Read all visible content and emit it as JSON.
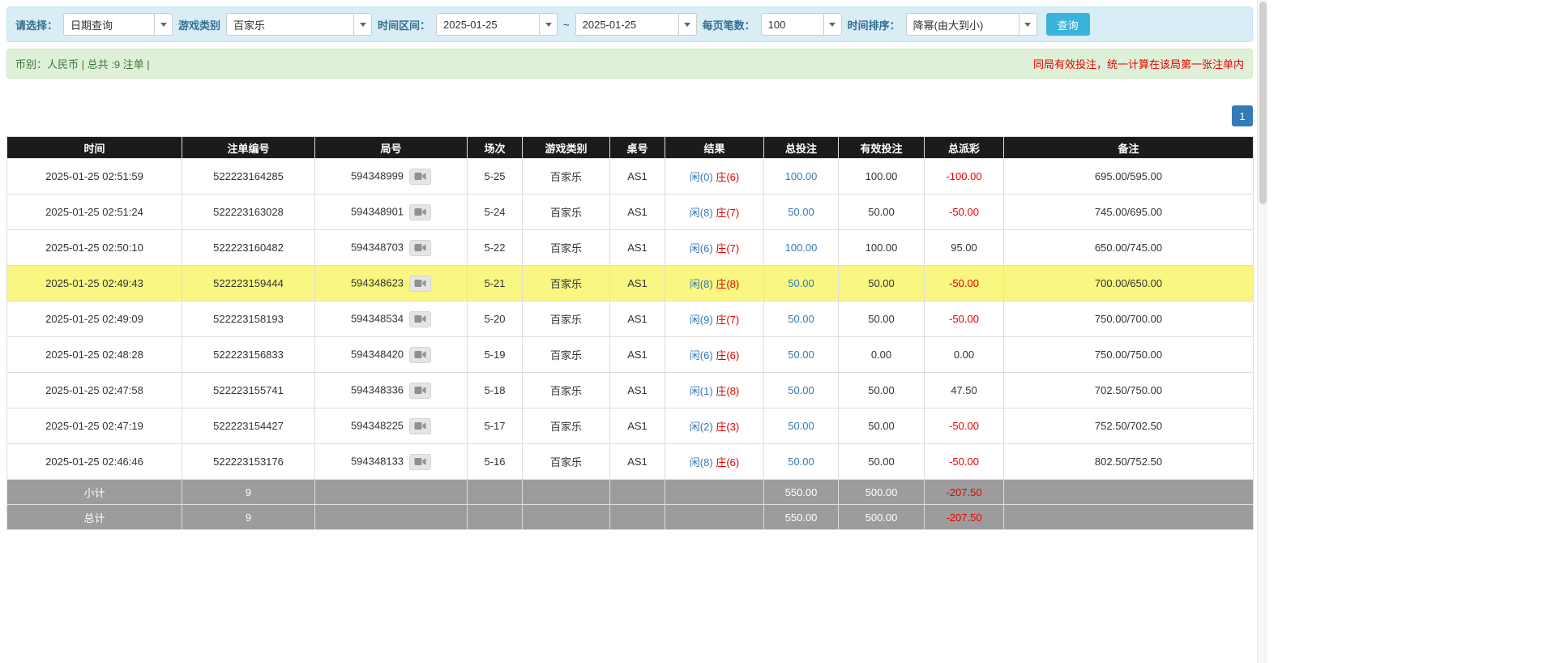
{
  "filters": {
    "select_label": "请选择：",
    "select_value": "日期查询",
    "game_type_label": "游戏类别",
    "game_type_value": "百家乐",
    "time_range_label": "时间区间：",
    "date_from": "2025-01-25",
    "tilde": "~",
    "date_to": "2025-01-25",
    "page_size_label": "每页笔数：",
    "page_size_value": "100",
    "sort_label": "时间排序：",
    "sort_value": "降幂(由大到小)",
    "search_button": "查询"
  },
  "summary": {
    "left": "币别：人民币 | 总共 :9 注单 |",
    "right_notice": "同局有效投注，统一计算在该局第一张注单内"
  },
  "pagination": {
    "current_page": "1"
  },
  "table": {
    "headers": [
      "时间",
      "注单编号",
      "局号",
      "场次",
      "游戏类别",
      "桌号",
      "结果",
      "总投注",
      "有效投注",
      "总派彩",
      "备注"
    ],
    "rows": [
      {
        "time": "2025-01-25 02:51:59",
        "bet_id": "522223164285",
        "round_id": "594348999",
        "session": "5-25",
        "game": "百家乐",
        "table_no": "AS1",
        "result_player": "闲(0)",
        "result_banker": "庄(6)",
        "total_bet": "100.00",
        "valid_bet": "100.00",
        "payout": "-100.00",
        "remark": "695.00/595.00",
        "highlight": false
      },
      {
        "time": "2025-01-25 02:51:24",
        "bet_id": "522223163028",
        "round_id": "594348901",
        "session": "5-24",
        "game": "百家乐",
        "table_no": "AS1",
        "result_player": "闲(8)",
        "result_banker": "庄(7)",
        "total_bet": "50.00",
        "valid_bet": "50.00",
        "payout": "-50.00",
        "remark": "745.00/695.00",
        "highlight": false
      },
      {
        "time": "2025-01-25 02:50:10",
        "bet_id": "522223160482",
        "round_id": "594348703",
        "session": "5-22",
        "game": "百家乐",
        "table_no": "AS1",
        "result_player": "闲(6)",
        "result_banker": "庄(7)",
        "total_bet": "100.00",
        "valid_bet": "100.00",
        "payout": "95.00",
        "remark": "650.00/745.00",
        "highlight": false
      },
      {
        "time": "2025-01-25 02:49:43",
        "bet_id": "522223159444",
        "round_id": "594348623",
        "session": "5-21",
        "game": "百家乐",
        "table_no": "AS1",
        "result_player": "闲(8)",
        "result_banker": "庄(8)",
        "total_bet": "50.00",
        "valid_bet": "50.00",
        "payout": "-50.00",
        "remark": "700.00/650.00",
        "highlight": true
      },
      {
        "time": "2025-01-25 02:49:09",
        "bet_id": "522223158193",
        "round_id": "594348534",
        "session": "5-20",
        "game": "百家乐",
        "table_no": "AS1",
        "result_player": "闲(9)",
        "result_banker": "庄(7)",
        "total_bet": "50.00",
        "valid_bet": "50.00",
        "payout": "-50.00",
        "remark": "750.00/700.00",
        "highlight": false
      },
      {
        "time": "2025-01-25 02:48:28",
        "bet_id": "522223156833",
        "round_id": "594348420",
        "session": "5-19",
        "game": "百家乐",
        "table_no": "AS1",
        "result_player": "闲(6)",
        "result_banker": "庄(6)",
        "total_bet": "50.00",
        "valid_bet": "0.00",
        "payout": "0.00",
        "remark": "750.00/750.00",
        "highlight": false
      },
      {
        "time": "2025-01-25 02:47:58",
        "bet_id": "522223155741",
        "round_id": "594348336",
        "session": "5-18",
        "game": "百家乐",
        "table_no": "AS1",
        "result_player": "闲(1)",
        "result_banker": "庄(8)",
        "total_bet": "50.00",
        "valid_bet": "50.00",
        "payout": "47.50",
        "remark": "702.50/750.00",
        "highlight": false
      },
      {
        "time": "2025-01-25 02:47:19",
        "bet_id": "522223154427",
        "round_id": "594348225",
        "session": "5-17",
        "game": "百家乐",
        "table_no": "AS1",
        "result_player": "闲(2)",
        "result_banker": "庄(3)",
        "total_bet": "50.00",
        "valid_bet": "50.00",
        "payout": "-50.00",
        "remark": "752.50/702.50",
        "highlight": false
      },
      {
        "time": "2025-01-25 02:46:46",
        "bet_id": "522223153176",
        "round_id": "594348133",
        "session": "5-16",
        "game": "百家乐",
        "table_no": "AS1",
        "result_player": "闲(8)",
        "result_banker": "庄(6)",
        "total_bet": "50.00",
        "valid_bet": "50.00",
        "payout": "-50.00",
        "remark": "802.50/752.50",
        "highlight": false
      }
    ],
    "subtotal": {
      "label": "小计",
      "count": "9",
      "total_bet": "550.00",
      "valid_bet": "500.00",
      "payout": "-207.50"
    },
    "total": {
      "label": "总计",
      "count": "9",
      "total_bet": "550.00",
      "valid_bet": "500.00",
      "payout": "-207.50"
    }
  },
  "icons": {
    "dropdown": "chevron-down-icon",
    "replay": "video-camera-icon"
  },
  "colors": {
    "filter_bar_bg": "#d9edf7",
    "filter_bar_border": "#bce8f1",
    "label_color": "#31708f",
    "button_cyan": "#39b3d7",
    "summary_bg": "#dff0d8",
    "summary_border": "#d6e9c6",
    "summary_text": "#3c763d",
    "notice_red": "#e60000",
    "link_blue": "#337ab7",
    "value_red": "#e60000",
    "header_bg": "#1b1b1b",
    "row_highlight": "#f9f781",
    "footer_bg": "#9c9c9c",
    "pagination_blue": "#337ab7"
  }
}
